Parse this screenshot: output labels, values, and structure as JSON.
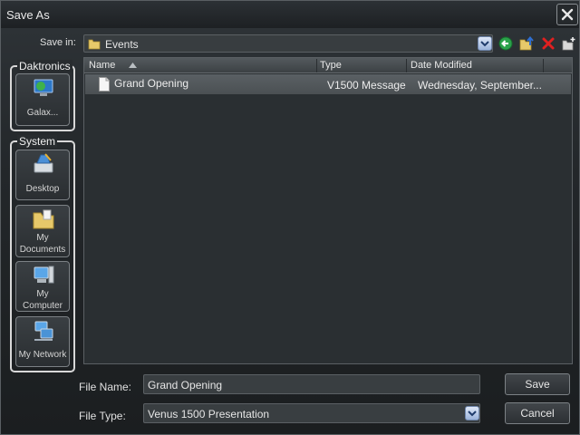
{
  "window": {
    "title": "Save As"
  },
  "toolbar": {
    "save_in_label": "Save in:",
    "current_folder": "Events"
  },
  "places": {
    "daktronics": {
      "title": "Daktronics",
      "items": [
        {
          "label": "Galax..."
        }
      ]
    },
    "system": {
      "title": "System",
      "items": [
        {
          "label": "Desktop"
        },
        {
          "label": "My Documents"
        },
        {
          "label": "My Computer"
        },
        {
          "label": "My Network"
        }
      ]
    }
  },
  "file_list": {
    "columns": [
      {
        "label": "Name"
      },
      {
        "label": "Type"
      },
      {
        "label": "Date Modified"
      }
    ],
    "rows": [
      {
        "name": "Grand Opening",
        "type": "V1500 Message",
        "date": "Wednesday, September..."
      }
    ]
  },
  "form": {
    "file_name_label": "File Name:",
    "file_name_value": "Grand Opening",
    "file_type_label": "File Type:",
    "file_type_value": "Venus 1500 Presentation"
  },
  "buttons": {
    "save": "Save",
    "cancel": "Cancel"
  },
  "colors": {
    "accent_blue": "#9bb3da",
    "delete_red": "#e02020",
    "back_green": "#2aa24a"
  }
}
